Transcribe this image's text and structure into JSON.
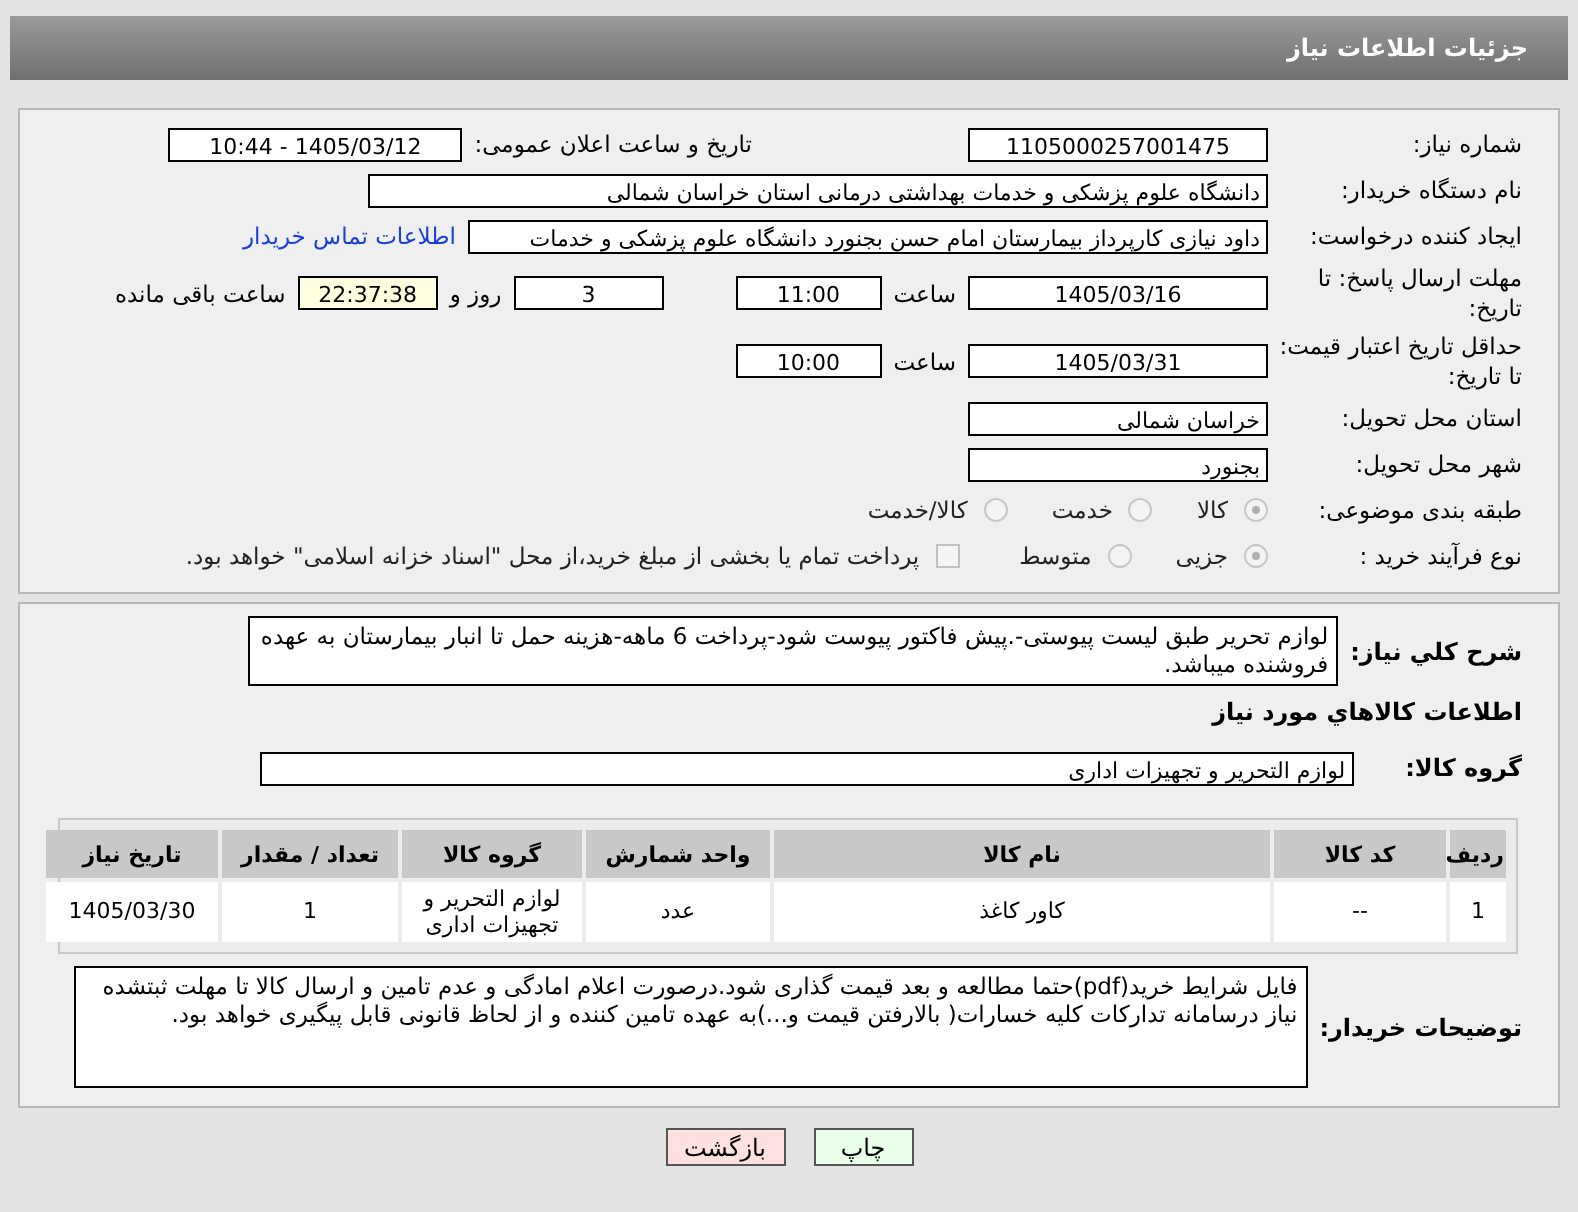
{
  "title": "جزئیات اطلاعات نیاز",
  "need_number": {
    "label": "شماره نیاز:",
    "value": "1105000257001475"
  },
  "announce": {
    "label": "تاریخ و ساعت اعلان عمومی:",
    "value": "1405/03/12 - 10:44"
  },
  "buyer_org": {
    "label": "نام دستگاه خریدار:",
    "value": "دانشگاه علوم پزشکی و خدمات بهداشتی درمانی استان خراسان شمالی"
  },
  "requester": {
    "label": "ایجاد کننده درخواست:",
    "value": "داود نیازی کارپرداز بیمارستان امام حسن بجنورد دانشگاه علوم پزشکی و خدمات",
    "link": "اطلاعات تماس خریدار"
  },
  "reply_deadline": {
    "label": "مهلت ارسال پاسخ: تا تاریخ:",
    "date": "1405/03/16",
    "time_label": "ساعت",
    "time": "11:00",
    "days": "3",
    "days_label": "روز و",
    "remaining": "22:37:38",
    "remaining_label": "ساعت باقی مانده"
  },
  "price_validity": {
    "label": "حداقل تاریخ اعتبار قیمت: تا تاریخ:",
    "date": "1405/03/31",
    "time_label": "ساعت",
    "time": "10:00"
  },
  "province": {
    "label": "استان محل تحویل:",
    "value": "خراسان شمالی"
  },
  "city": {
    "label": "شهر محل تحویل:",
    "value": "بجنورد"
  },
  "category": {
    "label": "طبقه بندی موضوعی:",
    "options": [
      {
        "label": "کالا",
        "selected": true
      },
      {
        "label": "خدمت",
        "selected": false
      },
      {
        "label": "کالا/خدمت",
        "selected": false
      }
    ]
  },
  "purchase_type": {
    "label": "نوع فرآیند خرید :",
    "options": [
      {
        "label": "جزیی",
        "selected": true
      },
      {
        "label": "متوسط",
        "selected": false
      }
    ],
    "treasury": {
      "label": "پرداخت تمام یا بخشی از مبلغ خرید،از محل \"اسناد خزانه اسلامی\" خواهد بود.",
      "checked": false
    }
  },
  "description": {
    "label": "شرح کلي نياز:",
    "value": "لوازم تحریر طبق لیست پیوستی-.پیش فاکتور پیوست  شود-پرداخت 6 ماهه-هزینه حمل تا انبار بیمارستان به عهده فروشنده میباشد."
  },
  "goods_heading": "اطلاعات کالاهاي مورد نياز",
  "goods_group": {
    "label": "گروه کالا:",
    "value": "لوازم التحریر و تجهیزات اداری"
  },
  "table": {
    "columns": [
      "ردیف",
      "کد کالا",
      "نام کالا",
      "واحد شمارش",
      "گروه کالا",
      "تعداد / مقدار",
      "تاریخ نیاز"
    ],
    "rows": [
      [
        "1",
        "--",
        "کاور کاغذ",
        "عدد",
        "لوازم التحریر و تجهیزات اداری",
        "1",
        "1405/03/30"
      ]
    ]
  },
  "notes": {
    "label": "توضیحات خریدار:",
    "value": "فایل شرایط خرید(pdf)حتما مطالعه و بعد قیمت گذاری شود.درصورت اعلام امادگی و عدم تامین و ارسال کالا تا مهلت ثبتشده نیاز درسامانه تدارکات کلیه خسارات( بالارفتن قیمت و...)به عهده تامین کننده و از لحاظ قانونی قابل پیگیری خواهد بود."
  },
  "buttons": [
    {
      "label": "چاپ",
      "kind": "print"
    },
    {
      "label": "بازگشت",
      "kind": "back"
    }
  ]
}
